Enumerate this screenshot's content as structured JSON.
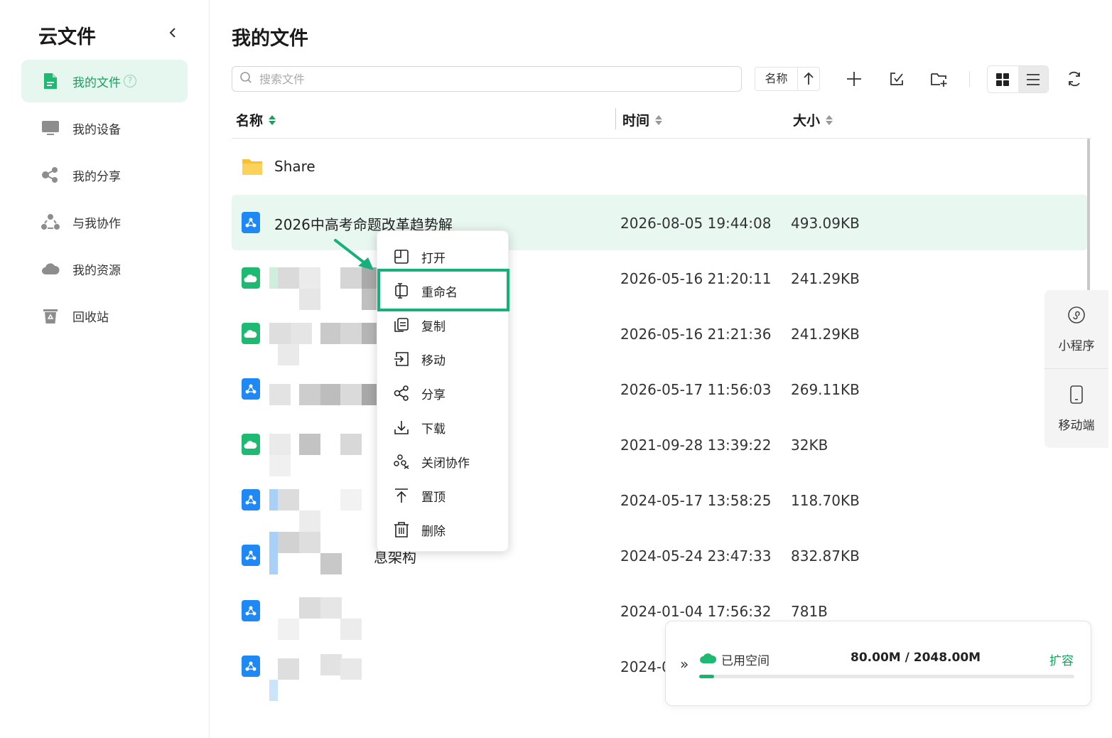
{
  "sidebar": {
    "app_title": "云文件",
    "items": [
      {
        "label": "我的文件",
        "icon": "document-icon",
        "active": true
      },
      {
        "label": "我的设备",
        "icon": "monitor-icon"
      },
      {
        "label": "我的分享",
        "icon": "share-icon"
      },
      {
        "label": "与我协作",
        "icon": "collaborate-icon"
      },
      {
        "label": "我的资源",
        "icon": "cloud-icon"
      },
      {
        "label": "回收站",
        "icon": "recycle-bin-icon"
      }
    ],
    "help_glyph": "?"
  },
  "main": {
    "title": "我的文件",
    "search": {
      "placeholder": "搜索文件",
      "value": ""
    },
    "sort": {
      "label": "名称",
      "direction": "ascending"
    },
    "columns": {
      "name": "名称",
      "time": "时间",
      "size": "大小"
    }
  },
  "rows": [
    {
      "name": "Share",
      "time": "",
      "size": "",
      "type": "folder"
    },
    {
      "name": "2026中高考命题改革趋势解",
      "time": "2026-08-05 19:44:08",
      "size": "493.09KB",
      "type": "collab-doc",
      "selected": true
    },
    {
      "name": "",
      "time": "2026-05-16 21:20:11",
      "size": "241.29KB",
      "type": "cloud-doc"
    },
    {
      "name": "",
      "time": "2026-05-16 21:21:36",
      "size": "241.29KB",
      "type": "cloud-doc"
    },
    {
      "name": "",
      "time": "2026-05-17 11:56:03",
      "size": "269.11KB",
      "type": "collab-doc"
    },
    {
      "name": "",
      "time": "2021-09-28 13:39:22",
      "size": "32KB",
      "type": "cloud-doc"
    },
    {
      "name": "",
      "time": "2024-05-17 13:58:25",
      "size": "118.70KB",
      "type": "collab-doc"
    },
    {
      "name": "息架构",
      "time": "2024-05-24 23:47:33",
      "size": "832.87KB",
      "type": "collab-doc"
    },
    {
      "name": "",
      "time": "2024-01-04 17:56:32",
      "size": "781B",
      "type": "collab-doc"
    },
    {
      "name": "",
      "time": "2024-0",
      "size": "",
      "type": "collab-doc"
    }
  ],
  "context_menu": [
    {
      "label": "打开",
      "icon": "open-icon"
    },
    {
      "label": "重命名",
      "icon": "rename-icon",
      "highlighted": true
    },
    {
      "label": "复制",
      "icon": "copy-icon"
    },
    {
      "label": "移动",
      "icon": "move-icon"
    },
    {
      "label": "分享",
      "icon": "share-icon"
    },
    {
      "label": "下载",
      "icon": "download-icon"
    },
    {
      "label": "关闭协作",
      "icon": "close-collaboration-icon"
    },
    {
      "label": "置顶",
      "icon": "pin-top-icon"
    },
    {
      "label": "删除",
      "icon": "trash-icon"
    }
  ],
  "float_panel": {
    "mini_program": "小程序",
    "mobile": "移动端"
  },
  "storage": {
    "collapse_glyph": "»",
    "label": "已用空间",
    "value": "80.00M / 2048.00M",
    "expand": "扩容",
    "used_fraction": 0.039
  },
  "colors": {
    "accent": "#19a05f",
    "selected_row": "#e8f7f0",
    "highlight_box": "#18b07a",
    "collab_icon": "#1e88f5",
    "cloud_icon": "#1fba72",
    "folder": "#f9c12e"
  }
}
